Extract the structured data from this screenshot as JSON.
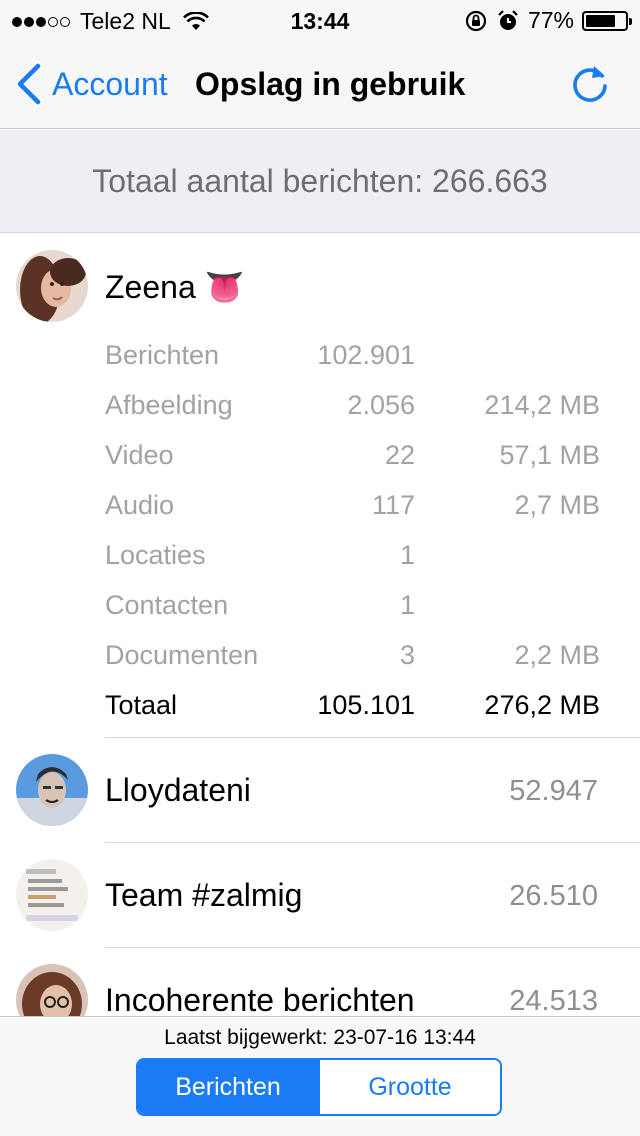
{
  "status_bar": {
    "carrier": "Tele2 NL",
    "time": "13:44",
    "battery": "77%",
    "battery_level": 0.77,
    "signal_bars_filled": 3,
    "signal_bars_total": 5
  },
  "nav": {
    "back_label": "Account",
    "title": "Opslag in gebruik",
    "refresh_icon": "refresh-icon",
    "accent_color": "#1a7cf5"
  },
  "summary": {
    "total_messages": "Totaal aantal berichten: 266.663"
  },
  "contacts": [
    {
      "name": "Zeena 👅",
      "expanded": true,
      "details": [
        {
          "label": "Berichten",
          "count": "102.901",
          "size": ""
        },
        {
          "label": "Afbeelding",
          "count": "2.056",
          "size": "214,2 MB"
        },
        {
          "label": "Video",
          "count": "22",
          "size": "57,1 MB"
        },
        {
          "label": "Audio",
          "count": "117",
          "size": "2,7 MB"
        },
        {
          "label": "Locaties",
          "count": "1",
          "size": ""
        },
        {
          "label": "Contacten",
          "count": "1",
          "size": ""
        },
        {
          "label": "Documenten",
          "count": "3",
          "size": "2,2 MB"
        },
        {
          "label": "Totaal",
          "count": "105.101",
          "size": "276,2 MB"
        }
      ]
    },
    {
      "name": "Lloydateni",
      "count": "52.947"
    },
    {
      "name": "Team #zalmig",
      "count": "26.510"
    },
    {
      "name": "Incoherente berichten",
      "count": "24.513"
    }
  ],
  "footer": {
    "last_updated": "Laatst bijgewerkt: 23-07-16 13:44",
    "segments": [
      "Berichten",
      "Grootte"
    ],
    "selected_segment": "Berichten"
  }
}
